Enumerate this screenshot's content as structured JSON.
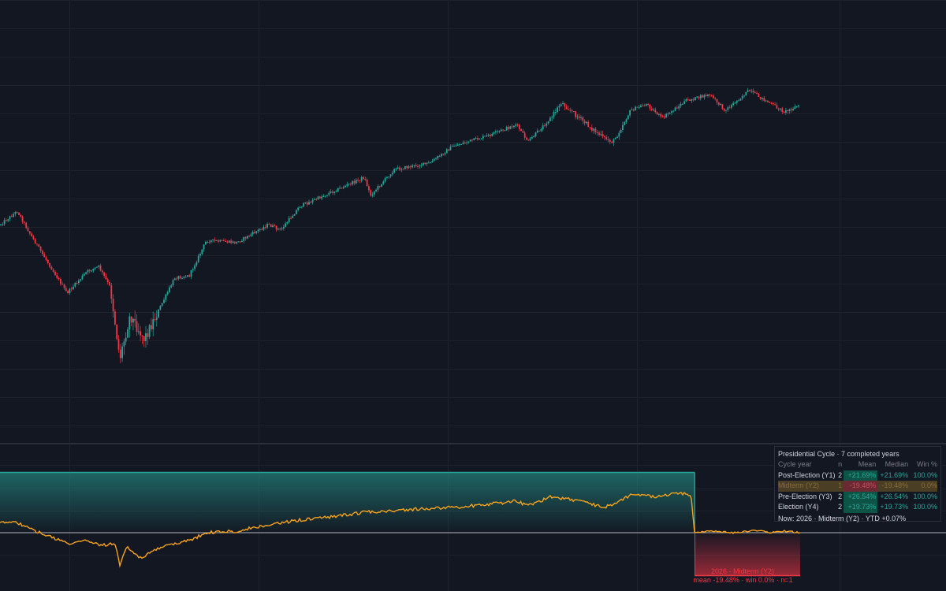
{
  "colors": {
    "background": "#131722",
    "grid": "#1e222d",
    "candle_up": "#26a69a",
    "candle_down": "#f23645",
    "price_line": "#f7a21b",
    "zero_line": "#b2b5be",
    "band_positive": "#26a69a",
    "band_negative": "#f23645"
  },
  "cycle_panel": {
    "title": "Presidential Cycle · 7 completed years",
    "headers": [
      "Cycle year",
      "n",
      "Mean",
      "Median",
      "Win %"
    ],
    "rows": [
      {
        "label": "Post-Election (Y1)",
        "n": "2",
        "mean": "+21.69%",
        "median": "+21.69%",
        "win": "100.0%"
      },
      {
        "label": "Midterm (Y2)",
        "n": "1",
        "mean": "-19.48%",
        "median": "-19.48%",
        "win": "0.0%"
      },
      {
        "label": "Pre-Election (Y3)",
        "n": "2",
        "mean": "+26.54%",
        "median": "+26.54%",
        "win": "100.0%"
      },
      {
        "label": "Election (Y4)",
        "n": "2",
        "mean": "+19.73%",
        "median": "+19.73%",
        "win": "100.0%"
      }
    ],
    "footer": "Now: 2026 · Midterm (Y2) · YTD +0.07%"
  },
  "current_year_label": "2026 · Midterm (Y2)",
  "current_year_stats": "mean -19.48% · win 0.0% · n=1"
}
